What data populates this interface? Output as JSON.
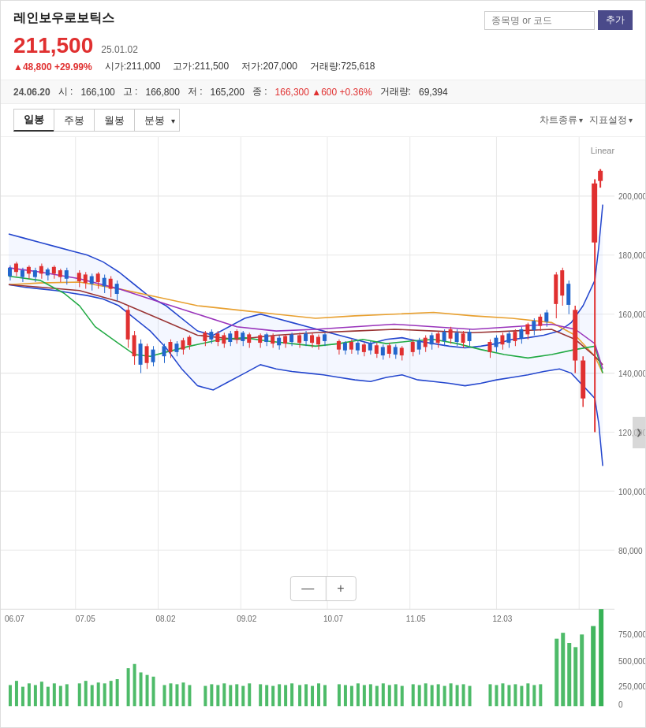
{
  "header": {
    "stock_name": "레인보우로보틱스",
    "current_price": "211,500",
    "date": "25.01.02",
    "change_amount": "▲48,800",
    "change_pct": "+29.99%",
    "open": "시가:211,000",
    "high": "고가:211,500",
    "low": "저가:207,000",
    "volume": "거래량:725,618",
    "search_placeholder": "종목명 or 코드",
    "add_btn": "추가"
  },
  "prev_day": {
    "date": "24.06.20",
    "open": "시",
    "open_val": "166,100",
    "high": "고",
    "high_val": "166,800",
    "low": "저",
    "low_val": "165,200",
    "close": "종",
    "close_val": "166,300",
    "close_arrow": "▲600",
    "close_pct": "+0.36%",
    "volume": "거래량",
    "volume_val": "69,394"
  },
  "periods": [
    {
      "label": "일봉",
      "active": true
    },
    {
      "label": "주봉",
      "active": false
    },
    {
      "label": "월봉",
      "active": false
    },
    {
      "label": "분봉",
      "active": false,
      "dropdown": true
    }
  ],
  "chart_options": [
    {
      "label": "차트종류"
    },
    {
      "label": "지표설정"
    }
  ],
  "chart": {
    "linear_label": "Linear",
    "y_axis": [
      "200,000",
      "180,000",
      "160,000",
      "140,000",
      "120,000",
      "100,000",
      "80,000"
    ],
    "y_axis_volume": [
      "750,000",
      "500,000",
      "250,000",
      "0"
    ],
    "x_axis": [
      "06.07",
      "07.05",
      "08.02",
      "09.02",
      "10.07",
      "11.05",
      "12.03"
    ],
    "zoom_minus": "—",
    "zoom_plus": "+"
  }
}
